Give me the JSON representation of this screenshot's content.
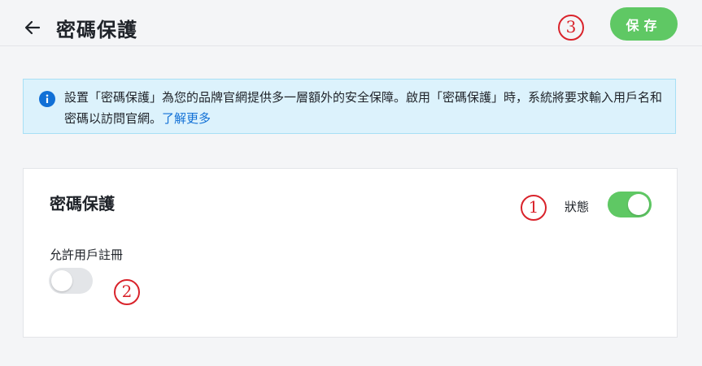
{
  "header": {
    "title": "密碼保護",
    "save_label": "保存"
  },
  "notice": {
    "text": "設置「密碼保護」為您的品牌官網提供多一層額外的安全保障。啟用「密碼保護」時，系統將要求輸入用戶名和密碼以訪問官網。",
    "link_text": "了解更多"
  },
  "card": {
    "title": "密碼保護",
    "status_label": "狀態",
    "status_on": true,
    "registration_label": "允許用戶註冊",
    "registration_on": false
  },
  "annotations": [
    "1",
    "2",
    "3"
  ],
  "colors": {
    "accent": "#5fc864",
    "link": "#1170d6",
    "info_bg": "#dcf2fc",
    "marker": "#d9232b"
  }
}
